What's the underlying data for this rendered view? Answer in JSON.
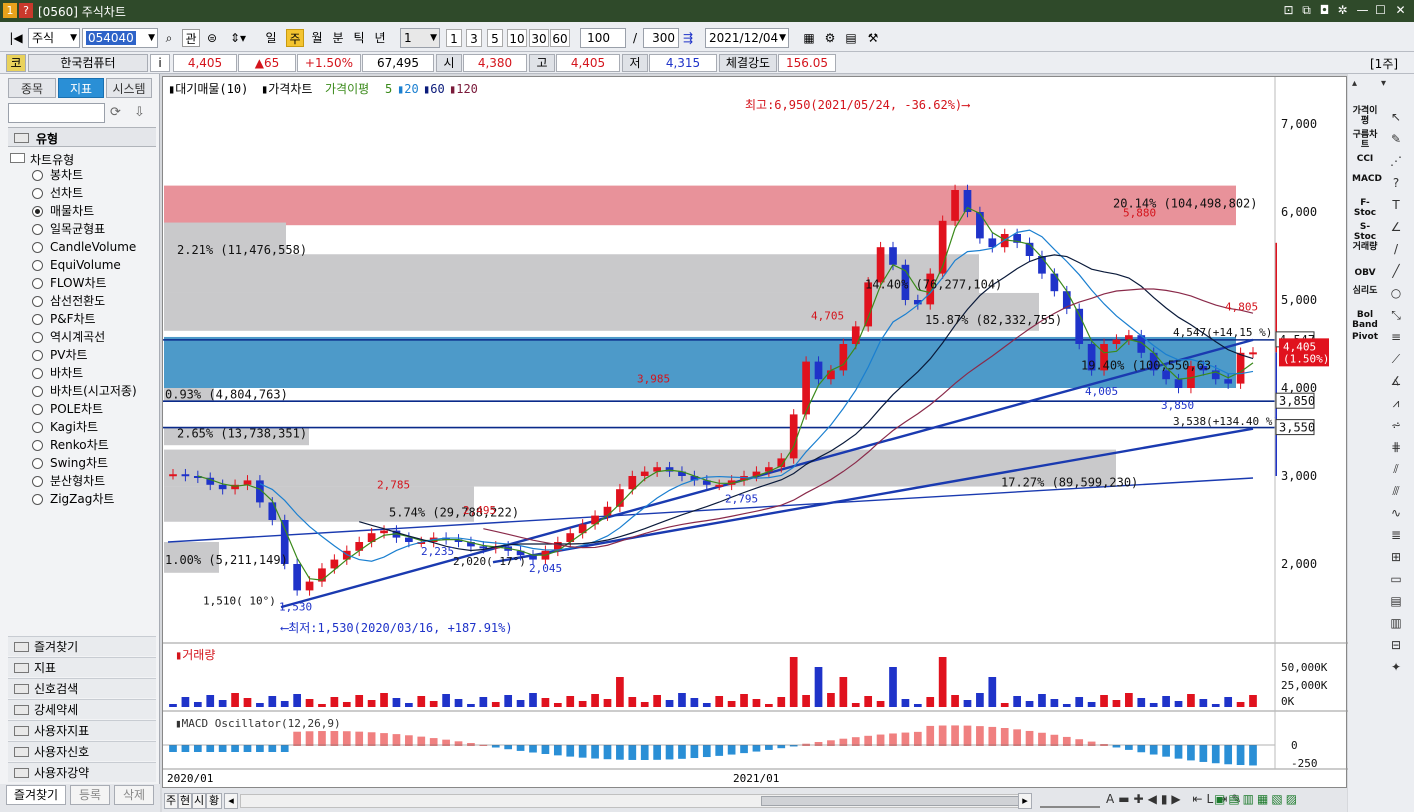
{
  "window": {
    "title": "[0560] 주식차트",
    "badges": [
      "1",
      "?"
    ]
  },
  "toolbar": {
    "market": "주식",
    "code": "054040",
    "btn_gwan": "관",
    "periods": [
      "일",
      "주",
      "월",
      "분",
      "틱",
      "년"
    ],
    "period_active": "주",
    "unit_value": "1",
    "quick_units": [
      "1",
      "3",
      "5",
      "10",
      "30",
      "60"
    ],
    "count": "100",
    "separator": "/",
    "total": "300",
    "date": "2021/12/04"
  },
  "quote": {
    "code_label": "코",
    "name": "한국컴퓨터",
    "info_label": "i",
    "price": "4,405",
    "change": "▲65",
    "rate": "+1.50%",
    "volume": "67,495",
    "open_label": "시",
    "open": "4,380",
    "high_label": "고",
    "high": "4,405",
    "low_label": "저",
    "low": "4,315",
    "strength_label": "체결강도",
    "strength": "156.05",
    "period_tag": "[1주]"
  },
  "left": {
    "tabs": [
      "종목",
      "지표",
      "시스템"
    ],
    "active_tab": "지표",
    "group_title": "유형",
    "tree_root": "차트유형",
    "types": [
      "봉차트",
      "선차트",
      "매물차트",
      "일목균형표",
      "CandleVolume",
      "EquiVolume",
      "FLOW차트",
      "삼선전환도",
      "P&F차트",
      "역시계곡선",
      "PV차트",
      "바차트",
      "바차트(시고저종)",
      "POLE차트",
      "Kagi차트",
      "Renko차트",
      "Swing차트",
      "분산형차트",
      "ZigZag차트"
    ],
    "selected_type": "매물차트",
    "folders": [
      "즐겨찾기",
      "지표",
      "신호검색",
      "강세약세",
      "사용자지표",
      "사용자신호",
      "사용자강약"
    ],
    "bottom_tabs": [
      "즐겨찾기",
      "등록",
      "삭제"
    ]
  },
  "chart": {
    "legend": {
      "a": "대기매물(10)",
      "b": "가격차트",
      "c": "가격이평",
      "ma": [
        "5",
        "20",
        "60",
        "120"
      ]
    },
    "high_note": "최고:6,950(2021/05/24, -36.62%)⟶",
    "low_note": "⟵최저:1,530(2020/03/16, +187.91%)",
    "y_labels": [
      "7,000",
      "6,000",
      "5,000",
      "4,000",
      "3,000",
      "2,000"
    ],
    "x_labels": [
      "2020/01",
      "2021/01"
    ],
    "price_tags": [
      "4,547",
      "3,850",
      "3,550"
    ],
    "current_tag": "4,405",
    "current_tag2": "(1.50%)",
    "volume_title": "거래량",
    "volume_labels": [
      "50,000K",
      "25,000K",
      "0K"
    ],
    "macd_title": "MACD Oscillator(12,26,9)",
    "macd_labels": [
      "0",
      "-250"
    ],
    "band_labels": [
      "20.14% (104,498,802)",
      "2.21% (11,476,558)",
      "14.40% (76,277,104)",
      "15.87% (82,332,755)",
      "19.40% (100,550,63",
      "0.93% (4,804,763)",
      "2.65% (13,738,351)",
      "17.27% (89,599,230)",
      "5.74% (29,788,222)",
      "1.00% (5,211,149)"
    ],
    "annotations": [
      "4,705",
      "3,985",
      "5,880",
      "4,805",
      "2,785",
      "2,495",
      "2,795",
      "2,235",
      "2,045",
      "4,005",
      "3,850",
      "1,530",
      "1,510( 10°)",
      "2,020( 17°)",
      "4,547(+14,15 %)",
      "3,538(+134.40 %)"
    ]
  },
  "right": {
    "indicators": [
      "가격이평",
      "구름차트",
      "CCI",
      "MACD",
      "F-Stoc",
      "S-Stoc",
      "거래량",
      "OBV",
      "심리도",
      "Bol Band",
      "Pivot"
    ]
  },
  "bottom": {
    "tabs": [
      "주",
      "현",
      "시",
      "황"
    ]
  },
  "colors": {
    "up": "#e0121e",
    "down": "#1f33c9",
    "band_red": "#e8929a",
    "band_blue": "#4d9ac9",
    "band_gray": "#c9c9cb"
  }
}
